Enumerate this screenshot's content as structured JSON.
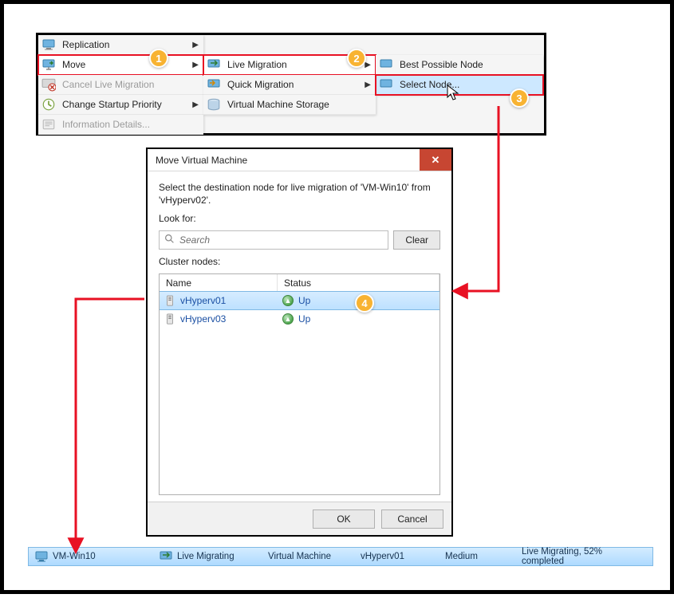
{
  "menus": {
    "col1": {
      "replication": "Replication",
      "move": "Move",
      "cancel_live_migration": "Cancel Live Migration",
      "change_startup_priority": "Change Startup Priority",
      "information_details": "Information Details..."
    },
    "col2": {
      "live_migration": "Live Migration",
      "quick_migration": "Quick Migration",
      "vm_storage": "Virtual Machine Storage"
    },
    "col3": {
      "best_possible_node": "Best Possible Node",
      "select_node": "Select Node..."
    }
  },
  "annotations": {
    "b1": "1",
    "b2": "2",
    "b3": "3",
    "b4": "4"
  },
  "dialog": {
    "title": "Move Virtual Machine",
    "description": "Select the destination node for live migration of 'VM-Win10' from 'vHyperv02'.",
    "look_for_label": "Look for:",
    "search_placeholder": "Search",
    "clear_btn": "Clear",
    "cluster_nodes_label": "Cluster nodes:",
    "columns": {
      "name": "Name",
      "status": "Status"
    },
    "nodes": [
      {
        "name": "vHyperv01",
        "status": "Up",
        "selected": true
      },
      {
        "name": "vHyperv03",
        "status": "Up",
        "selected": false
      }
    ],
    "ok_btn": "OK",
    "cancel_btn": "Cancel"
  },
  "status": {
    "vm_name": "VM-Win10",
    "state": "Live Migrating",
    "type": "Virtual Machine",
    "owner": "vHyperv01",
    "priority": "Medium",
    "info": "Live Migrating, 52% completed"
  }
}
